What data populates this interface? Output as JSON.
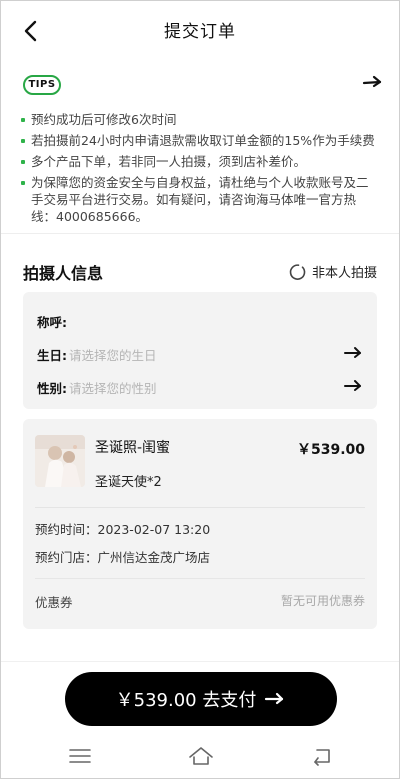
{
  "header": {
    "title": "提交订单"
  },
  "tips": {
    "badge": "TIPS",
    "items": [
      "预约成功后可修改6次时间",
      "若拍摄前24小时内申请退款需收取订单金额的15%作为手续费",
      "多个产品下单，若非同一人拍摄，须到店补差价。",
      "为保障您的资金安全与自身权益，请杜绝与个人收款账号及二手交易平台进行交易。如有疑问，请咨询海马体唯一官方热线：4000685666。"
    ]
  },
  "photographer": {
    "section_title": "拍摄人信息",
    "not_self_label": "非本人拍摄",
    "fields": [
      {
        "label": "称呼:",
        "value": ""
      },
      {
        "label": "生日:",
        "value": "请选择您的生日"
      },
      {
        "label": "性别:",
        "value": "请选择您的性别"
      }
    ]
  },
  "order": {
    "product_name": "圣诞照-闺蜜",
    "price": "￥539.00",
    "spec": "圣诞天使*2",
    "appointment_time": "预约时间：2023-02-07 13:20",
    "appointment_store": "预约门店：广州信达金茂广场店",
    "coupon_label": "优惠券",
    "coupon_value": "暂无可用优惠券"
  },
  "pay": {
    "label": "￥539.00  去支付"
  },
  "colors": {
    "accent": "#2fb34a",
    "button": "#000000",
    "card_bg": "#f3f3f3"
  }
}
